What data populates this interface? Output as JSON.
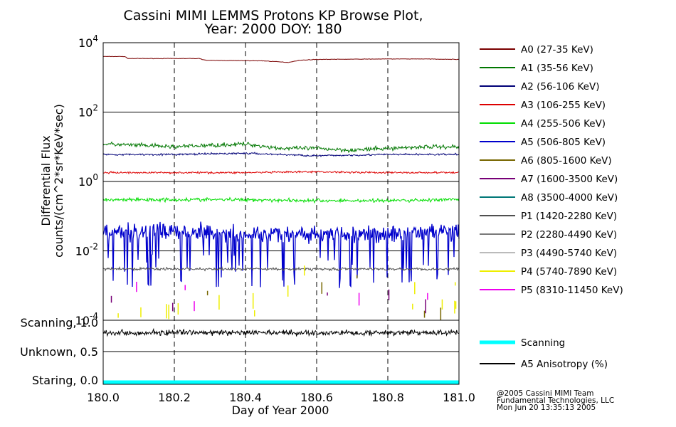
{
  "chart_data": {
    "type": "line",
    "title": "Cassini MIMI LEMMS Protons KP Browse Plot,",
    "subtitle": "Year: 2000 DOY: 180",
    "xlabel": "Day of Year 2000",
    "ylabel": "Differential Flux",
    "ylabel_units": "counts/(cm^2*sr*KeV*sec)",
    "y_scale": "log",
    "xlim": [
      180.0,
      181.0
    ],
    "ylim": [
      0.0001,
      10000
    ],
    "x_ticks": [
      "180.0",
      "180.2",
      "180.4",
      "180.6",
      "180.8",
      "181.0"
    ],
    "y_ticks": [
      {
        "base": "10",
        "exp": "4",
        "value": 10000
      },
      {
        "base": "10",
        "exp": "2",
        "value": 100
      },
      {
        "base": "10",
        "exp": "0",
        "value": 1
      },
      {
        "base": "10",
        "exp": "-2",
        "value": 0.01
      },
      {
        "base": "10",
        "exp": "-4",
        "value": 0.0001
      }
    ],
    "grid": true,
    "legend_position": "right",
    "series": [
      {
        "name": "A0 (27-35 KeV)",
        "color": "#7a0000",
        "values": [
          {
            "x": 180.0,
            "y": 4000
          },
          {
            "x": 180.06,
            "y": 4000
          },
          {
            "x": 180.07,
            "y": 3500
          },
          {
            "x": 180.27,
            "y": 3500
          },
          {
            "x": 180.29,
            "y": 3100
          },
          {
            "x": 180.45,
            "y": 3000
          },
          {
            "x": 180.52,
            "y": 2700
          },
          {
            "x": 180.55,
            "y": 3100
          },
          {
            "x": 180.6,
            "y": 3300
          },
          {
            "x": 180.8,
            "y": 3400
          },
          {
            "x": 180.9,
            "y": 3400
          },
          {
            "x": 181.0,
            "y": 3300
          }
        ]
      },
      {
        "name": "A1 (35-56 KeV)",
        "color": "#007700",
        "values": [
          {
            "x": 180.0,
            "y": 12
          },
          {
            "x": 180.1,
            "y": 11
          },
          {
            "x": 180.2,
            "y": 10
          },
          {
            "x": 180.3,
            "y": 11
          },
          {
            "x": 180.4,
            "y": 12
          },
          {
            "x": 180.5,
            "y": 9
          },
          {
            "x": 180.6,
            "y": 9
          },
          {
            "x": 180.7,
            "y": 8
          },
          {
            "x": 180.8,
            "y": 9
          },
          {
            "x": 180.9,
            "y": 10
          },
          {
            "x": 181.0,
            "y": 10
          }
        ]
      },
      {
        "name": "A2 (56-106 KeV)",
        "color": "#000077",
        "values": [
          {
            "x": 180.0,
            "y": 6
          },
          {
            "x": 180.2,
            "y": 6
          },
          {
            "x": 180.4,
            "y": 6.5
          },
          {
            "x": 180.6,
            "y": 5.5
          },
          {
            "x": 180.8,
            "y": 6
          },
          {
            "x": 181.0,
            "y": 6
          }
        ]
      },
      {
        "name": "A3 (106-255 KeV)",
        "color": "#dd0000",
        "values": [
          {
            "x": 180.0,
            "y": 1.8
          },
          {
            "x": 180.2,
            "y": 1.8
          },
          {
            "x": 180.4,
            "y": 1.8
          },
          {
            "x": 180.6,
            "y": 1.9
          },
          {
            "x": 180.8,
            "y": 1.8
          },
          {
            "x": 181.0,
            "y": 1.8
          }
        ]
      },
      {
        "name": "A4 (255-506 KeV)",
        "color": "#00dd00",
        "values": [
          {
            "x": 180.0,
            "y": 0.3
          },
          {
            "x": 180.2,
            "y": 0.3
          },
          {
            "x": 180.4,
            "y": 0.3
          },
          {
            "x": 180.6,
            "y": 0.28
          },
          {
            "x": 180.8,
            "y": 0.28
          },
          {
            "x": 181.0,
            "y": 0.3
          }
        ]
      },
      {
        "name": "A5 (506-805 KeV)",
        "color": "#0000cc",
        "values": [
          {
            "x": 180.0,
            "y": 0.03
          },
          {
            "x": 180.2,
            "y": 0.04
          },
          {
            "x": 180.4,
            "y": 0.03
          },
          {
            "x": 180.6,
            "y": 0.03
          },
          {
            "x": 180.8,
            "y": 0.03
          },
          {
            "x": 181.0,
            "y": 0.04
          }
        ]
      },
      {
        "name": "A6 (805-1600 KeV)",
        "color": "#776600",
        "values": []
      },
      {
        "name": "A7 (1600-3500 KeV)",
        "color": "#770077",
        "values": []
      },
      {
        "name": "A8 (3500-4000 KeV)",
        "color": "#007777",
        "values": []
      },
      {
        "name": "P1 (1420-2280 KeV)",
        "color": "#505050",
        "values": [
          {
            "x": 180.0,
            "y": 0.003
          },
          {
            "x": 180.2,
            "y": 0.003
          },
          {
            "x": 180.4,
            "y": 0.003
          },
          {
            "x": 180.6,
            "y": 0.003
          },
          {
            "x": 180.8,
            "y": 0.003
          },
          {
            "x": 181.0,
            "y": 0.003
          }
        ]
      },
      {
        "name": "P2 (2280-4490 KeV)",
        "color": "#7a7a7a",
        "values": []
      },
      {
        "name": "P3 (4490-5740 KeV)",
        "color": "#bbbbbb",
        "values": []
      },
      {
        "name": "P4 (5740-7890 KeV)",
        "color": "#eeee00",
        "values": []
      },
      {
        "name": "P5 (8310-11450 KeV)",
        "color": "#ee00ee",
        "values": []
      }
    ],
    "lower_panel": {
      "y_labels": [
        "Scanning, 1.0",
        "Unknown, 0.5",
        "Staring, 0.0"
      ],
      "series": [
        {
          "name": "Scanning",
          "color": "#00ffff"
        },
        {
          "name": "A5 Anisotropy (%)",
          "color": "#000000"
        }
      ]
    }
  },
  "credit": {
    "line1": "@2005 Cassini MIMI Team",
    "line2": "Fundamental Technologies, LLC",
    "line3": "Mon Jun 20 13:35:13 2005"
  }
}
